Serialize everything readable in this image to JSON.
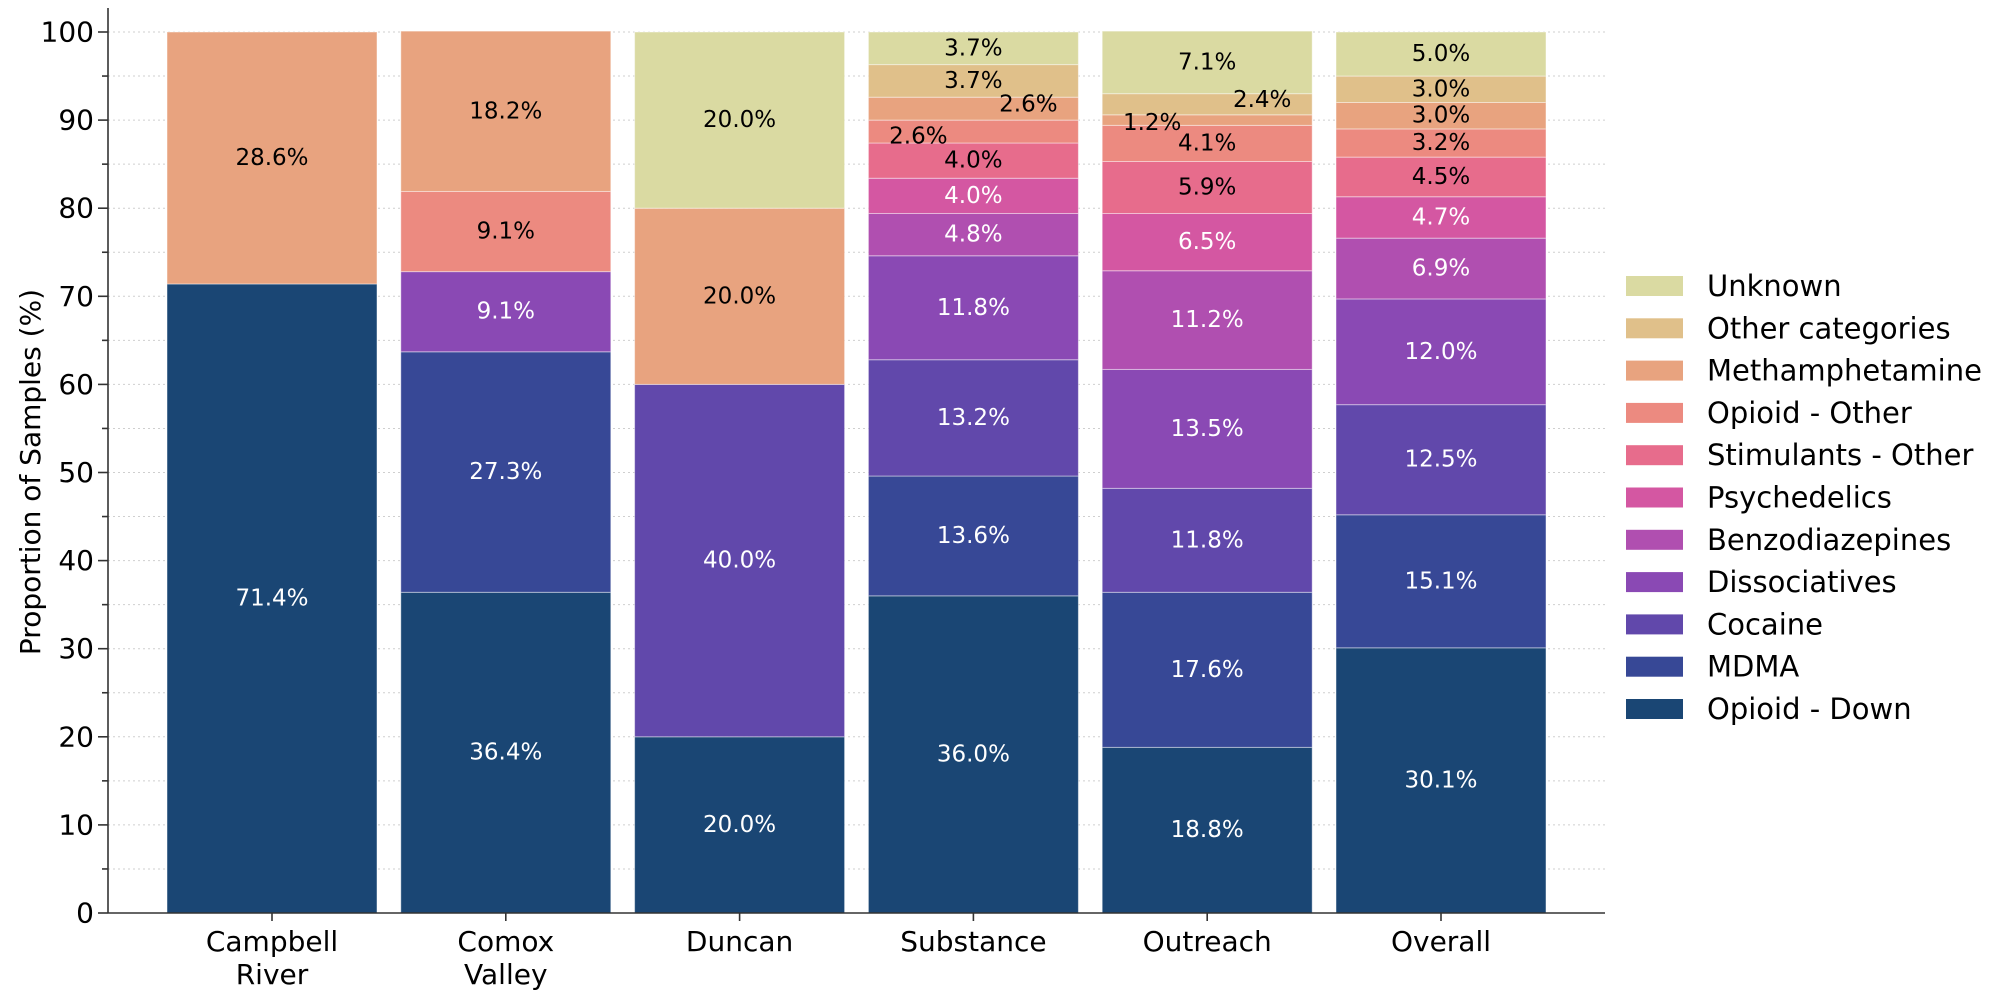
{
  "chart_data": {
    "type": "bar",
    "stacked": true,
    "title": "",
    "xlabel": "",
    "ylabel": "Proportion of Samples (%)",
    "ylim": [
      0,
      100
    ],
    "yticks": [
      0,
      10,
      20,
      30,
      40,
      50,
      60,
      70,
      80,
      90,
      100
    ],
    "grid": true,
    "legend_position": "right",
    "categories": [
      [
        "Campbell",
        "River"
      ],
      [
        "Comox",
        "Valley"
      ],
      [
        "Duncan"
      ],
      [
        "Substance"
      ],
      [
        "Outreach"
      ],
      [
        "Overall"
      ]
    ],
    "series": [
      {
        "name": "Opioid - Down",
        "color": "#1a4674",
        "label_color": "#ffffff",
        "values": [
          71.4,
          36.4,
          20.0,
          36.0,
          18.8,
          30.1
        ]
      },
      {
        "name": "MDMA",
        "color": "#374896",
        "label_color": "#ffffff",
        "values": [
          0,
          27.3,
          0,
          13.6,
          17.6,
          15.1
        ]
      },
      {
        "name": "Cocaine",
        "color": "#6148ab",
        "label_color": "#ffffff",
        "values": [
          0,
          0,
          40.0,
          13.2,
          11.8,
          12.5
        ]
      },
      {
        "name": "Dissociatives",
        "color": "#8a49b4",
        "label_color": "#ffffff",
        "values": [
          0,
          9.1,
          0,
          11.8,
          13.5,
          12.0
        ]
      },
      {
        "name": "Benzodiazepines",
        "color": "#b04fb0",
        "label_color": "#ffffff",
        "values": [
          0,
          0,
          0,
          4.8,
          11.2,
          6.9
        ]
      },
      {
        "name": "Psychedelics",
        "color": "#d457a2",
        "label_color": "#ffffff",
        "values": [
          0,
          0,
          0,
          4.0,
          6.5,
          4.7
        ]
      },
      {
        "name": "Stimulants - Other",
        "color": "#e76c8c",
        "label_color": "#000000",
        "values": [
          0,
          0,
          0,
          4.0,
          5.9,
          4.5
        ]
      },
      {
        "name": "Opioid - Other",
        "color": "#ec8a80",
        "label_color": "#000000",
        "values": [
          0,
          9.1,
          0,
          2.6,
          4.1,
          3.2
        ]
      },
      {
        "name": "Methamphetamine",
        "color": "#e8a37f",
        "label_color": "#000000",
        "values": [
          28.6,
          18.2,
          20.0,
          2.6,
          1.2,
          3.0
        ]
      },
      {
        "name": "Other categories",
        "color": "#e0c08a",
        "label_color": "#000000",
        "values": [
          0,
          0,
          0,
          3.7,
          2.4,
          3.0
        ]
      },
      {
        "name": "Unknown",
        "color": "#dadaa2",
        "label_color": "#000000",
        "values": [
          0,
          0,
          20.0,
          3.7,
          7.1,
          5.0
        ]
      }
    ],
    "data_labels": [
      [
        "71.4%",
        "",
        "",
        "",
        "",
        "",
        "",
        "",
        "28.6%",
        "",
        ""
      ],
      [
        "36.4%",
        "27.3%",
        "",
        "9.1%",
        "",
        "",
        "",
        "9.1%",
        "18.2%",
        "",
        ""
      ],
      [
        "20.0%",
        "",
        "40.0%",
        "",
        "",
        "",
        "",
        "",
        "20.0%",
        "",
        "20.0%"
      ],
      [
        "36.0%",
        "13.6%",
        "13.2%",
        "11.8%",
        "4.8%",
        "4.0%",
        "4.0%",
        "2.6%",
        "2.6%",
        "3.7%",
        "3.7%"
      ],
      [
        "18.8%",
        "17.6%",
        "11.8%",
        "13.5%",
        "11.2%",
        "6.5%",
        "5.9%",
        "4.1%",
        "1.2%",
        "2.4%",
        "7.1%"
      ],
      [
        "30.1%",
        "15.1%",
        "12.5%",
        "12.0%",
        "6.9%",
        "4.7%",
        "4.5%",
        "3.2%",
        "3.0%",
        "3.0%",
        "5.0%"
      ]
    ],
    "label_offsets": {
      "3-7": "left",
      "3-8": "right",
      "4-8": "left",
      "4-9": "right"
    },
    "legend_order": [
      "Unknown",
      "Other categories",
      "Methamphetamine",
      "Opioid - Other",
      "Stimulants - Other",
      "Psychedelics",
      "Benzodiazepines",
      "Dissociatives",
      "Cocaine",
      "MDMA",
      "Opioid - Down"
    ]
  }
}
